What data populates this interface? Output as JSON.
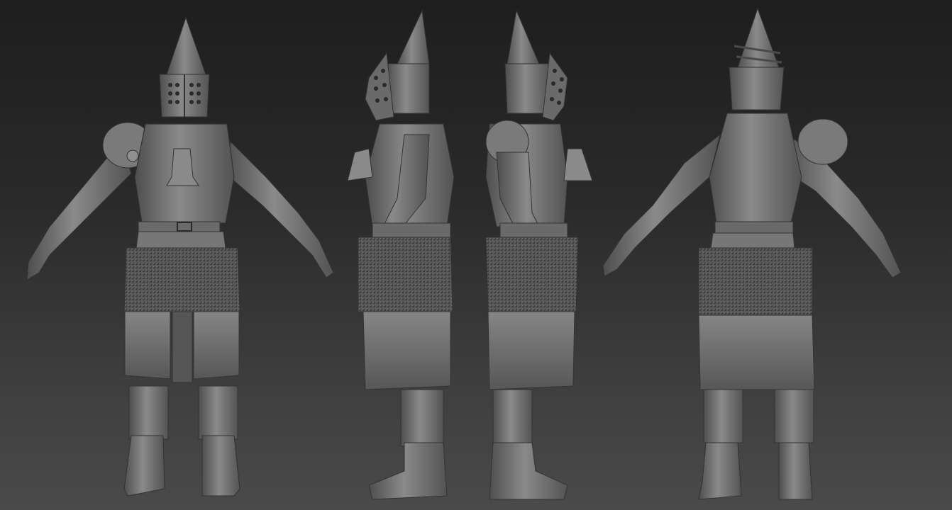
{
  "scene": {
    "views": [
      "front",
      "left-side",
      "right-side",
      "back"
    ],
    "material": "matcap-gray",
    "background": "gradient-dark-gray"
  },
  "colors": {
    "bg_top": "#1e1e1e",
    "bg_bottom": "#4a4a4a",
    "clay_light": "#8e8e8e",
    "clay_mid": "#6f6f6f",
    "clay_dark": "#4a4a4a",
    "clay_shadow": "#2f2f2f"
  }
}
